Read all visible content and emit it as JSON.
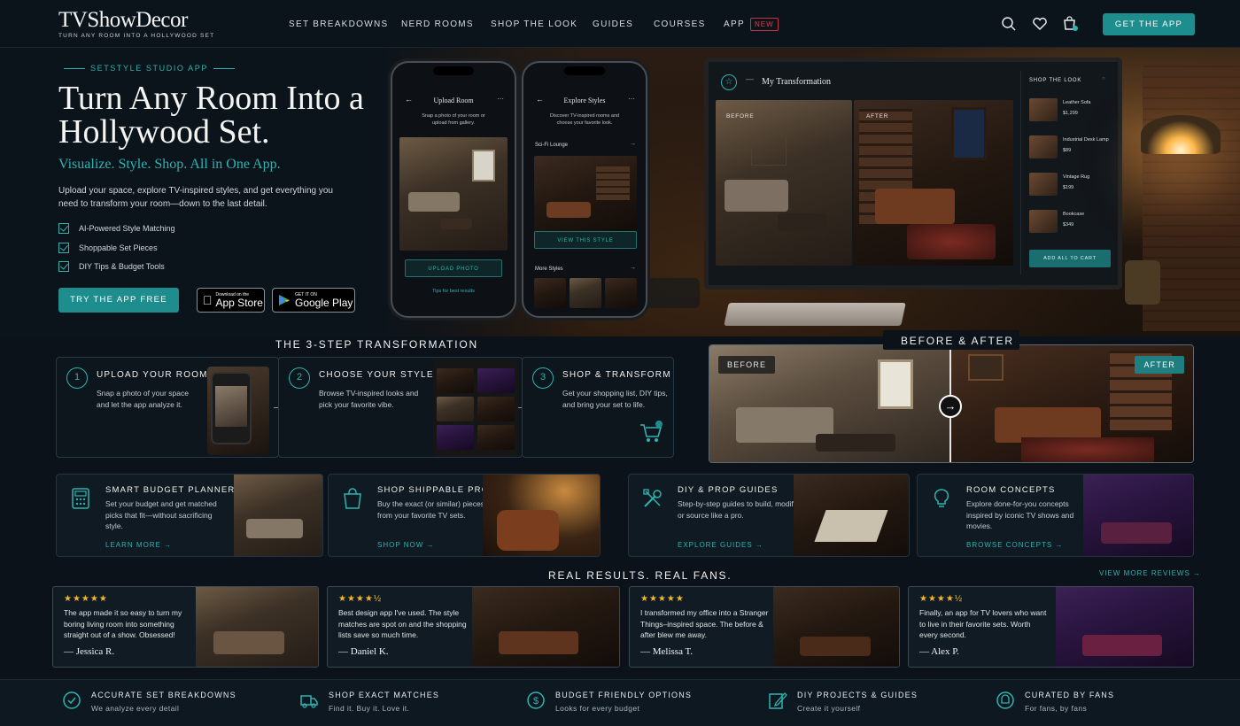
{
  "brand": {
    "name": "TVShowDecor",
    "tagline": "TURN ANY ROOM INTO A HOLLYWOOD SET"
  },
  "nav": {
    "links": [
      "SET BREAKDOWNS",
      "NERD ROOMS",
      "SHOP THE LOOK",
      "GUIDES",
      "COURSES",
      "APP"
    ],
    "new_badge": "NEW",
    "cta": "GET THE APP",
    "icons": [
      "search-icon",
      "heart-icon",
      "cart-icon"
    ]
  },
  "hero": {
    "kicker": "SETSTYLE STUDIO APP",
    "title": "Turn Any Room Into a Hollywood Set.",
    "subtitle": "Visualize. Style. Shop. All in One App.",
    "description": "Upload your space, explore TV-inspired styles, and get everything you need to transform your room—down to the last detail.",
    "features": [
      "AI-Powered Style Matching",
      "Shoppable Set Pieces",
      "DIY Tips & Budget Tools"
    ],
    "cta": "TRY THE APP FREE",
    "app_store": {
      "small": "Download on the",
      "big": "App Store"
    },
    "google_play": {
      "small": "GET IT ON",
      "big": "Google Play"
    }
  },
  "phone1": {
    "title": "Upload Room",
    "text": "Snap a photo of your room or upload from gallery.",
    "button": "UPLOAD PHOTO",
    "tip": "Tips for best results"
  },
  "phone2": {
    "title": "Explore Styles",
    "text": "Discover TV-inspired rooms and choose your favorite look.",
    "style_name": "Sci-Fi Lounge",
    "button": "VIEW THIS STYLE",
    "more": "More Styles"
  },
  "monitor": {
    "title": "My Transformation",
    "before": "BEFORE",
    "after": "AFTER",
    "shop_title": "SHOP THE LOOK",
    "items": [
      {
        "name": "Leather Sofa",
        "price": "$1,299"
      },
      {
        "name": "Industrial Desk Lamp",
        "price": "$89"
      },
      {
        "name": "Vintage Rug",
        "price": "$199"
      },
      {
        "name": "Bookcase",
        "price": "$349"
      }
    ],
    "add_all": "ADD ALL TO CART"
  },
  "steps": {
    "title": "THE 3-STEP TRANSFORMATION",
    "items": [
      {
        "num": "1",
        "title": "UPLOAD YOUR ROOM",
        "text": "Snap a photo of your space and let the app analyze it."
      },
      {
        "num": "2",
        "title": "CHOOSE YOUR STYLE",
        "text": "Browse TV-inspired looks and pick your favorite vibe."
      },
      {
        "num": "3",
        "title": "SHOP & TRANSFORM",
        "text": "Get your shopping list, DIY tips, and bring your set to life."
      }
    ]
  },
  "before_after": {
    "title": "BEFORE & AFTER",
    "before": "BEFORE",
    "after": "AFTER"
  },
  "features": [
    {
      "title": "SMART BUDGET PLANNER",
      "text": "Set your budget and get matched picks that fit—without sacrificing style.",
      "link": "LEARN MORE",
      "icon": "calculator-icon"
    },
    {
      "title": "SHOP SHIPPABLE PROPS",
      "text": "Buy the exact (or similar) pieces from your favorite TV sets.",
      "link": "SHOP NOW",
      "icon": "shopping-bag-icon"
    },
    {
      "title": "DIY & PROP GUIDES",
      "text": "Step-by-step guides to build, modify, or source like a pro.",
      "link": "EXPLORE GUIDES",
      "icon": "tools-icon"
    },
    {
      "title": "ROOM CONCEPTS",
      "text": "Explore done-for-you concepts inspired by iconic TV shows and movies.",
      "link": "BROWSE CONCEPTS",
      "icon": "lightbulb-icon"
    }
  ],
  "reviews": {
    "title": "REAL RESULTS. REAL FANS.",
    "view_more": "VIEW MORE REVIEWS",
    "items": [
      {
        "stars": "★★★★★",
        "rating": 5,
        "quote": "The app made it so easy to turn my boring living room into something straight out of a show. Obsessed!",
        "author": "— Jessica R."
      },
      {
        "stars": "★★★★½",
        "rating": 4.5,
        "quote": "Best design app I've used. The style matches are spot on and the shopping lists save so much time.",
        "author": "— Daniel K."
      },
      {
        "stars": "★★★★★",
        "rating": 5,
        "quote": "I transformed my office into a Stranger Things–inspired space. The before & after blew me away.",
        "author": "— Melissa T."
      },
      {
        "stars": "★★★★½",
        "rating": 4.5,
        "quote": "Finally, an app for TV lovers who want to live in their favorite sets. Worth every second.",
        "author": "— Alex P."
      }
    ]
  },
  "bottom_bar": [
    {
      "title": "ACCURATE SET BREAKDOWNS",
      "text": "We analyze every detail",
      "icon": "check-circle-icon"
    },
    {
      "title": "SHOP EXACT MATCHES",
      "text": "Find it. Buy it. Love it.",
      "icon": "truck-icon"
    },
    {
      "title": "BUDGET FRIENDLY OPTIONS",
      "text": "Looks for every budget",
      "icon": "dollar-icon"
    },
    {
      "title": "DIY PROJECTS & GUIDES",
      "text": "Create it yourself",
      "icon": "edit-icon"
    },
    {
      "title": "CURATED BY FANS",
      "text": "For fans, by fans",
      "icon": "fan-badge-icon"
    }
  ],
  "colors": {
    "accent": "#2fb3b1",
    "button": "#1e8d8e",
    "background": "#0b1219",
    "badge": "#e23b4a",
    "stars": "#f1b82f"
  }
}
